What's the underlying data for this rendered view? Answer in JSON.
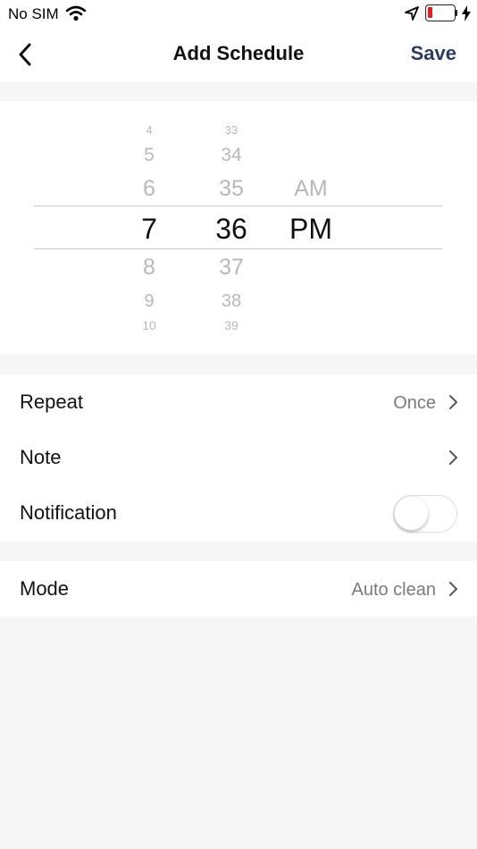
{
  "status_bar": {
    "carrier": "No SIM",
    "battery_color": "#e02020",
    "icons": [
      "wifi-icon",
      "location-arrow-icon",
      "battery-icon",
      "charging-bolt-icon"
    ]
  },
  "nav": {
    "back_icon": "chevron-left-icon",
    "title": "Add Schedule",
    "save_label": "Save",
    "save_color": "#2b3c5e"
  },
  "picker": {
    "hours": [
      "4",
      "5",
      "6",
      "7",
      "8",
      "9",
      "10"
    ],
    "minutes": [
      "33",
      "34",
      "35",
      "36",
      "37",
      "38",
      "39"
    ],
    "periods": [
      "AM",
      "PM"
    ],
    "selected_hour": "7",
    "selected_minute": "36",
    "selected_period": "PM"
  },
  "settings": {
    "repeat": {
      "label": "Repeat",
      "value": "Once"
    },
    "note": {
      "label": "Note"
    },
    "notification": {
      "label": "Notification",
      "enabled": false
    },
    "mode": {
      "label": "Mode",
      "value": "Auto clean"
    }
  }
}
